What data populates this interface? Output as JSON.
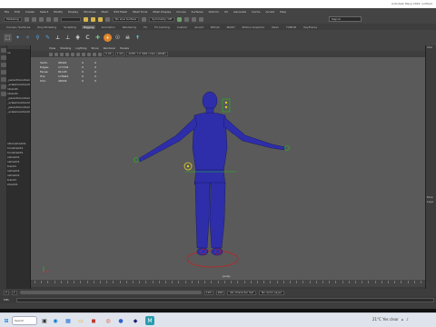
{
  "window": {
    "title": "Autodesk Maya 2022: untitled"
  },
  "menus": [
    "File",
    "Edit",
    "Create",
    "Select",
    "Modify",
    "Display",
    "Windows",
    "Mesh",
    "Edit Mesh",
    "Mesh Tools",
    "Mesh Display",
    "Curves",
    "Surfaces",
    "Deform",
    "UV",
    "Generate",
    "Cache",
    "Arnold",
    "Help"
  ],
  "status_line": {
    "mode": "Modeling",
    "live_surface": "No Live Surface",
    "symmetry": "Symmetry: Off",
    "sign_in": "Sign In"
  },
  "shelf_tabs": [
    {
      "label": "Curves / Surfaces",
      "active": false
    },
    {
      "label": "Poly Modeling",
      "active": false
    },
    {
      "label": "Sculpting",
      "active": false
    },
    {
      "label": "Rigging",
      "active": true
    },
    {
      "label": "Animation",
      "active": false
    },
    {
      "label": "Rendering",
      "active": false
    },
    {
      "label": "FX",
      "active": false
    },
    {
      "label": "FX Caching",
      "active": false
    },
    {
      "label": "Custom",
      "active": false
    },
    {
      "label": "Arnold",
      "active": false
    },
    {
      "label": "Bifrost",
      "active": false
    },
    {
      "label": "MASH",
      "active": false
    },
    {
      "label": "Motion Graphics",
      "active": false
    },
    {
      "label": "XGen",
      "active": false
    },
    {
      "label": "TURTLE",
      "active": false
    },
    {
      "label": "KeyFrame",
      "active": false
    }
  ],
  "shelf_icons": [
    "select-tool-icon",
    "joint-tool-icon",
    "ik-handle-icon",
    "bind-skin-icon",
    "paint-weights-icon",
    "skeleton-icon",
    "bone-icon",
    "lattice-icon",
    "cluster-icon",
    "locator-icon",
    "joint-orient-icon",
    "humanik-icon",
    "skull-icon",
    "control-icon"
  ],
  "viewport": {
    "menu": [
      "View",
      "Shading",
      "Lighting",
      "Show",
      "Renderer",
      "Panels"
    ],
    "fields": {
      "exposure": "0.00",
      "gamma": "1.00",
      "color_space": "ACES 1.0 SDR-video (sRGB)"
    },
    "camera_label": "persp",
    "hud": [
      [
        "Verts:",
        "98491",
        "0",
        "0"
      ],
      [
        "Edges:",
        "177704",
        "0",
        "0"
      ],
      [
        "Faces:",
        "81103",
        "0",
        "0"
      ],
      [
        "Tris:",
        "178041",
        "0",
        "0"
      ],
      [
        "UVs:",
        "48934",
        "0",
        "0"
      ]
    ]
  },
  "outliner": {
    "rows": [
      "ns",
      "",
      "",
      "",
      "",
      "",
      "_parentConstraint1",
      "_scaleConstraint1",
      "ntraint1",
      "ntraint1",
      "_parentConstraint",
      "_scaleConstraint1",
      "_parentConstraint1",
      "_scaleConstraint1",
      "",
      "",
      "",
      "",
      "",
      "",
      "ntConstraint1",
      "Constraint1",
      "Constraint1",
      "nstraint1",
      "nstraint1",
      "traint1",
      "nstraint1",
      "nstraint1",
      "traint1",
      "straint1"
    ]
  },
  "channel_box": {
    "rows": [
      "Cha",
      "",
      "",
      "",
      "",
      "",
      "",
      "",
      "",
      "",
      "",
      "",
      "",
      "",
      "",
      "",
      "",
      "",
      "",
      "",
      "",
      "",
      "",
      "",
      "",
      "",
      "",
      "",
      "",
      "",
      "",
      "",
      "",
      "Disp",
      "Laye"
    ]
  },
  "time_range": {
    "start": "1",
    "current": "1",
    "end": "120",
    "range_end": "200",
    "character_set": "No Character Set",
    "anim_layer": "No Anim Layer"
  },
  "command_line": {
    "label": "MEL"
  },
  "taskbar": {
    "search_placeholder": "Search",
    "weather": "21°C  Yes clear",
    "time": "",
    "colors": {
      "accent": "#0078d4"
    }
  }
}
